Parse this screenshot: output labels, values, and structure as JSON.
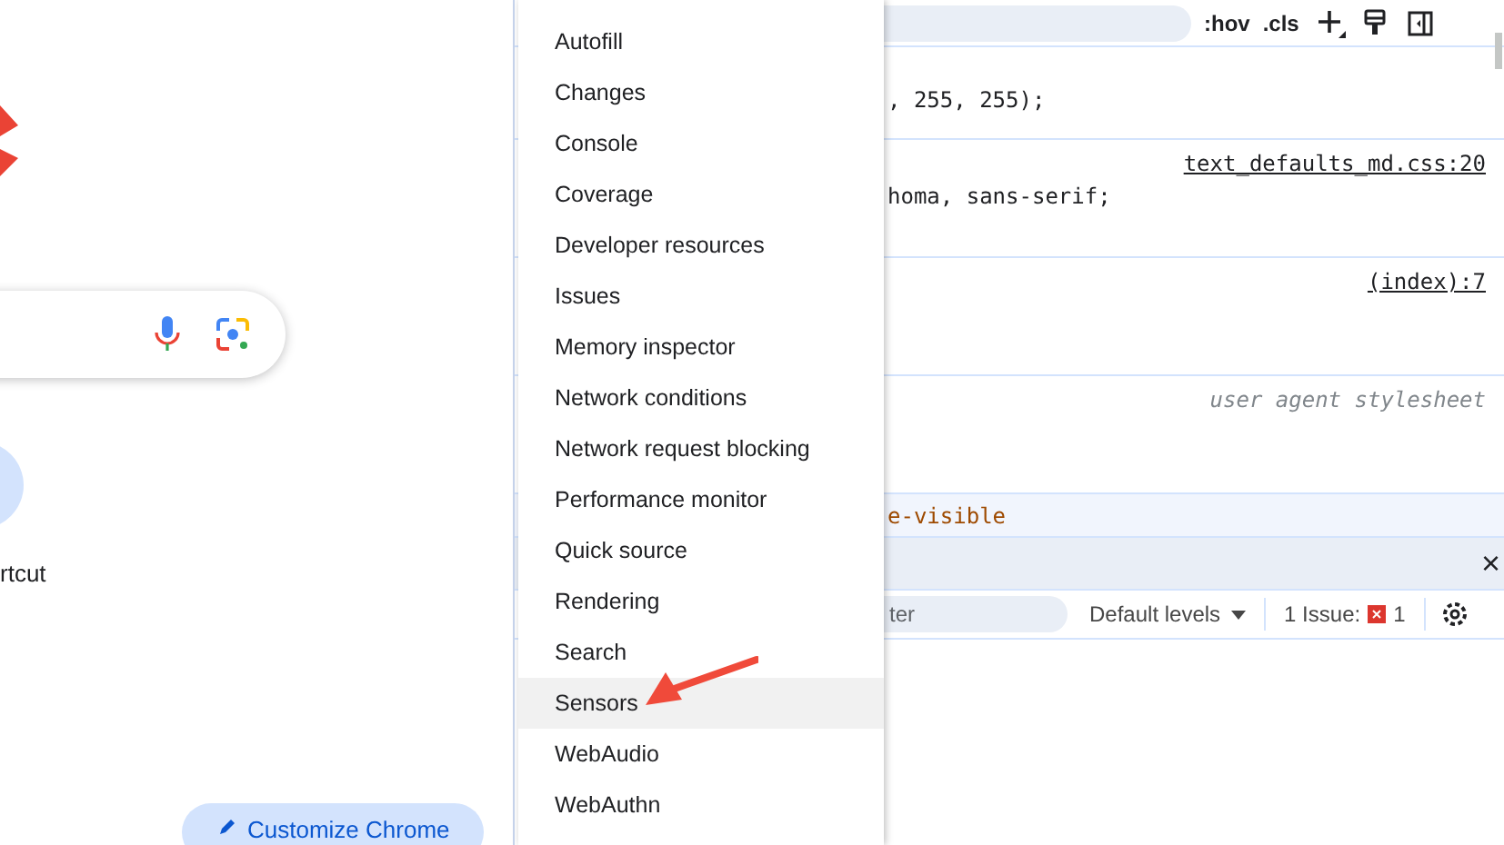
{
  "new_tab": {
    "shortcut_label": "rtcut",
    "customize_button": "Customize Chrome"
  },
  "styles_toolbar": {
    "hov": ":hov",
    "cls": ".cls"
  },
  "rules": [
    {
      "kind": "value",
      "text": ", 255, 255);"
    },
    {
      "kind": "source_value",
      "source": "text_defaults_md.css:20",
      "text": "homa, sans-serif;"
    },
    {
      "kind": "source",
      "source": "(index):7"
    },
    {
      "kind": "agent",
      "source": "user agent stylesheet"
    },
    {
      "kind": "selector",
      "text": "e-visible"
    }
  ],
  "drawer": {
    "close": "×"
  },
  "console_toolbar": {
    "filter_placeholder": "ter",
    "levels": "Default levels",
    "issues_label": "1 Issue:",
    "issues_count": "1"
  },
  "more_tools_menu": [
    {
      "label": "Autofill",
      "selected": false
    },
    {
      "label": "Changes",
      "selected": false
    },
    {
      "label": "Console",
      "selected": false
    },
    {
      "label": "Coverage",
      "selected": false
    },
    {
      "label": "Developer resources",
      "selected": false
    },
    {
      "label": "Issues",
      "selected": false
    },
    {
      "label": "Memory inspector",
      "selected": false
    },
    {
      "label": "Network conditions",
      "selected": false
    },
    {
      "label": "Network request blocking",
      "selected": false
    },
    {
      "label": "Performance monitor",
      "selected": false
    },
    {
      "label": "Quick source",
      "selected": false
    },
    {
      "label": "Rendering",
      "selected": false
    },
    {
      "label": "Search",
      "selected": false
    },
    {
      "label": "Sensors",
      "selected": true
    },
    {
      "label": "WebAudio",
      "selected": false
    },
    {
      "label": "WebAuthn",
      "selected": false
    }
  ]
}
